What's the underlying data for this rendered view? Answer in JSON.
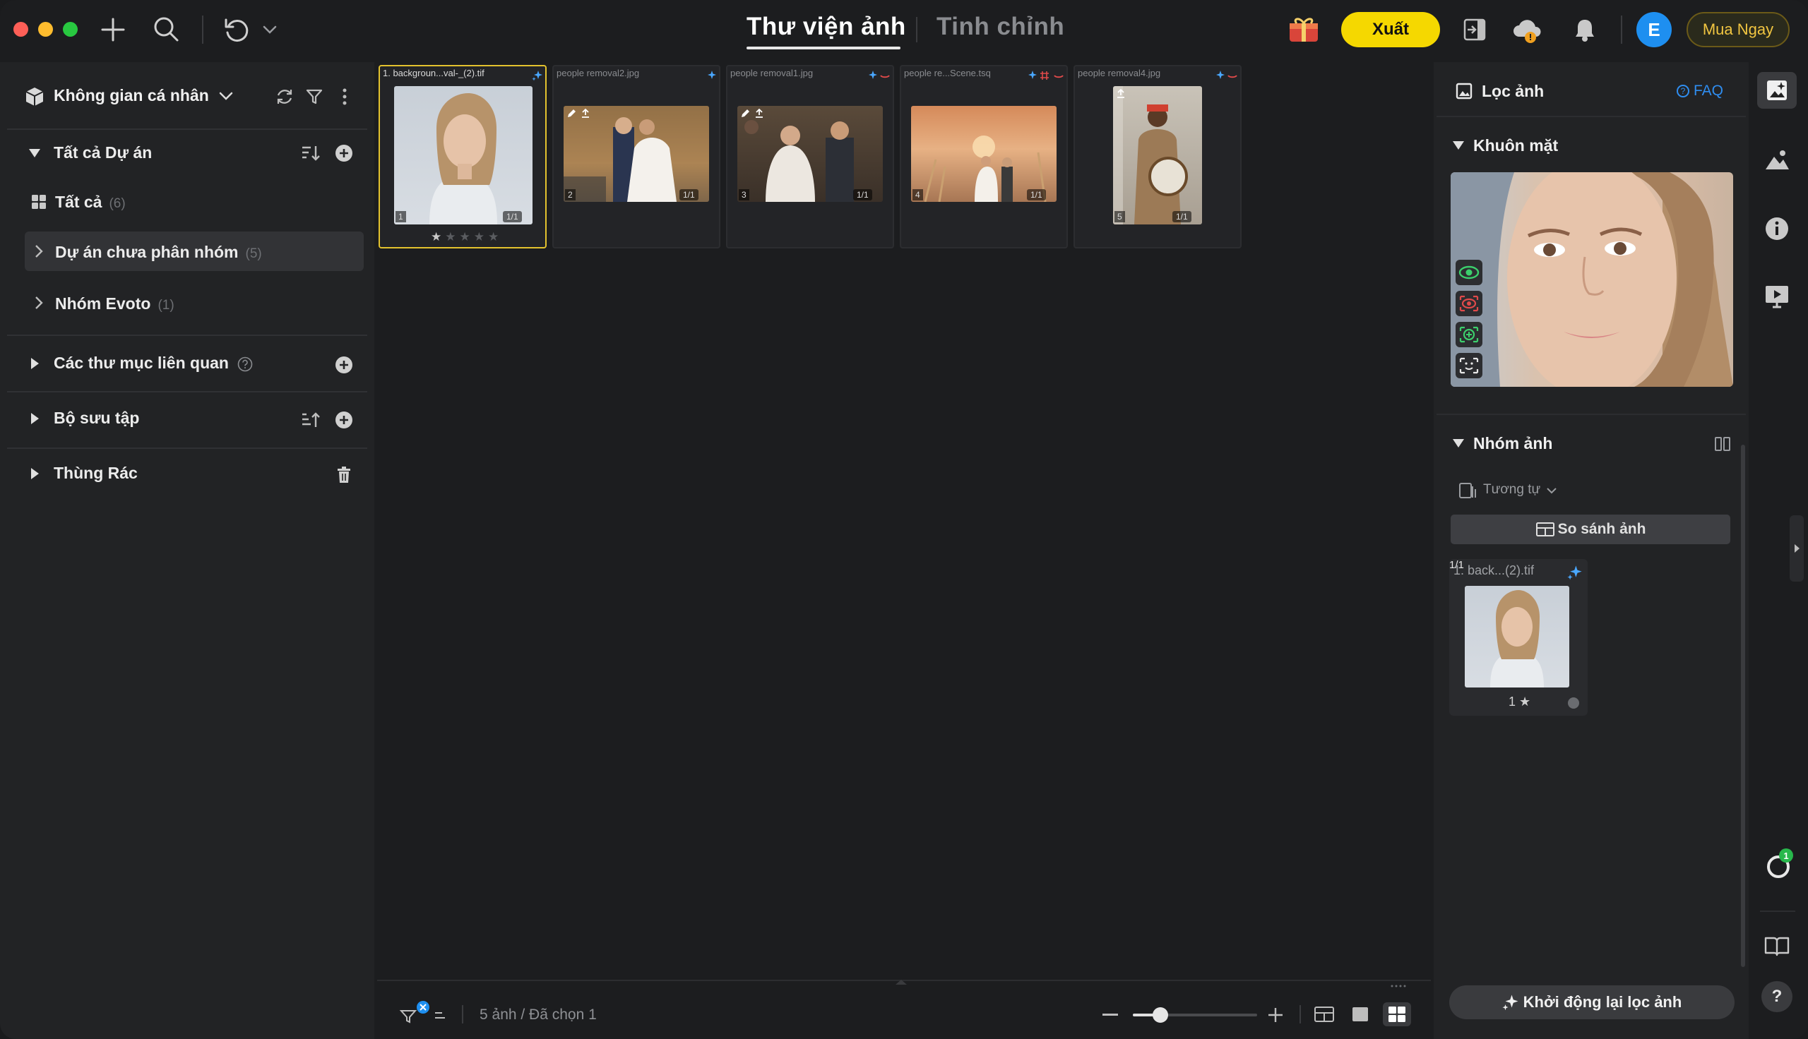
{
  "colors": {
    "accent": "#f5d800",
    "link": "#2f8df0",
    "avatar": "#1e8ff0",
    "selected_border": "#e3c22e"
  },
  "header": {
    "tabs": [
      {
        "label": "Thư viện ảnh",
        "active": true
      },
      {
        "label": "Tinh chỉnh",
        "active": false
      }
    ],
    "export_label": "Xuất",
    "avatar_letter": "E",
    "buy_label": "Mua Ngay"
  },
  "sidebar": {
    "workspace": "Không gian cá nhân",
    "all_projects": "Tất cả Dự án",
    "items": [
      {
        "label": "Tất cả",
        "count": "(6)"
      },
      {
        "label": "Dự án chưa phân nhóm",
        "count": "(5)"
      },
      {
        "label": "Nhóm Evoto",
        "count": "(1)"
      }
    ],
    "related_folders": "Các thư mục liên quan",
    "collections": "Bộ sưu tập",
    "trash": "Thùng Rác"
  },
  "library": {
    "thumbnails": [
      {
        "filename": "1. backgroun...val-_(2).tif",
        "index": "1",
        "version": "1/1",
        "selected": true
      },
      {
        "filename": "people removal2.jpg",
        "index": "2",
        "version": "1/1",
        "selected": false
      },
      {
        "filename": "people removal1.jpg",
        "index": "3",
        "version": "1/1",
        "selected": false
      },
      {
        "filename": "people re...Scene.tsq",
        "index": "4",
        "version": "1/1",
        "selected": false
      },
      {
        "filename": "people removal4.jpg",
        "index": "5",
        "version": "1/1",
        "selected": false
      }
    ],
    "rating_stars": "★★★★★",
    "status": "5 ảnh / Đã chọn 1",
    "zoom_fraction": 0.22
  },
  "filter_panel": {
    "title": "Lọc ảnh",
    "faq": "FAQ",
    "face_section": "Khuôn mặt",
    "group_section": "Nhóm ảnh",
    "similarity": "Tương tự",
    "compare": "So sánh ảnh",
    "group_card": {
      "filename": "1. back...(2).tif",
      "version": "1/1",
      "rating": "1 ★"
    },
    "restart": "Khởi động lại lọc ảnh"
  },
  "strip": {
    "badge": "1",
    "help": "?"
  }
}
